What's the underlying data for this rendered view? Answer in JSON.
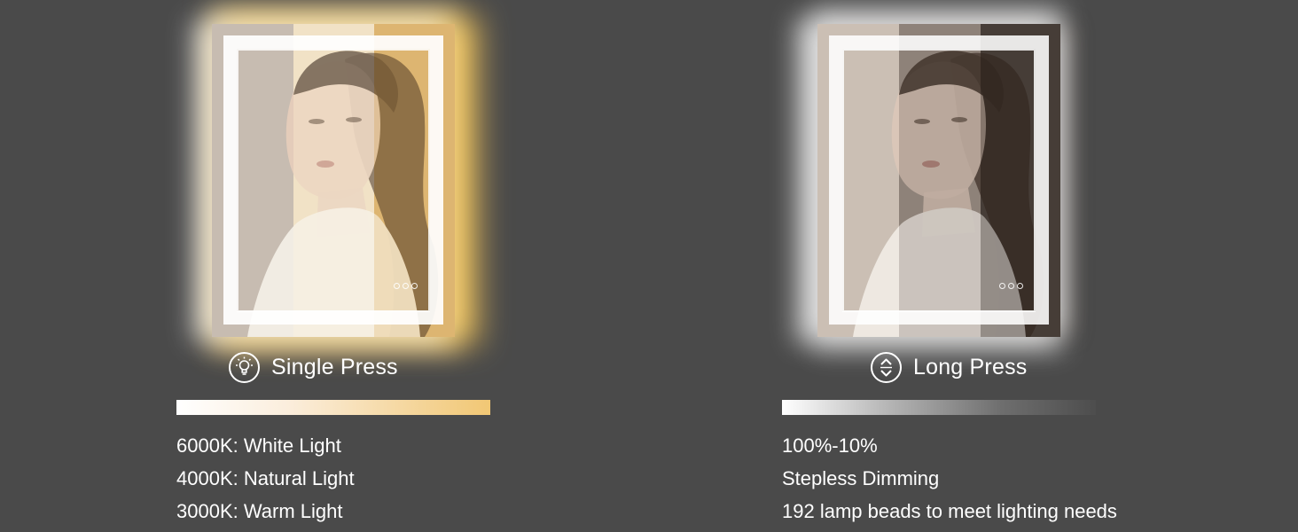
{
  "left_panel": {
    "caption": "Single Press",
    "icon": "bulb-icon",
    "bar_colors": [
      "#ffffff",
      "#f1c774"
    ],
    "band_colors": [
      "#c9bdb2",
      "#f3e2c2",
      "#e9c98a"
    ],
    "specs": [
      "6000K: White Light",
      "4000K: Natural Light",
      "3000K: Warm Light"
    ]
  },
  "right_panel": {
    "caption": "Long Press",
    "icon": "up-down-arrows-icon",
    "bar_colors": [
      "#ffffff",
      "#4a4a4a"
    ],
    "band_colors": [
      "#cfc4ba",
      "#9d9189",
      "#5c524b"
    ],
    "specs": [
      "100%-10%",
      "Stepless Dimming",
      "192 lamp beads to meet lighting needs"
    ]
  }
}
